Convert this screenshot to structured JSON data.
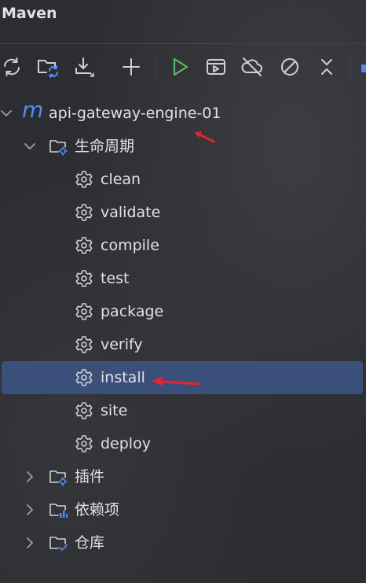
{
  "panel": {
    "title": "Maven"
  },
  "toolbar": {
    "buttons": [
      {
        "icon": "reload-icon"
      },
      {
        "icon": "generate-sources-icon"
      },
      {
        "icon": "download-icon"
      },
      {
        "icon": "add-icon"
      },
      {
        "icon": "run-icon"
      },
      {
        "icon": "execute-goal-icon"
      },
      {
        "icon": "offline-icon"
      },
      {
        "icon": "skip-tests-icon"
      },
      {
        "icon": "collapse-all-icon"
      }
    ]
  },
  "tree": {
    "project": {
      "label": "api-gateway-engine-01",
      "logo": "m"
    },
    "lifecycle": {
      "label": "生命周期",
      "goals": [
        {
          "label": "clean"
        },
        {
          "label": "validate"
        },
        {
          "label": "compile"
        },
        {
          "label": "test"
        },
        {
          "label": "package"
        },
        {
          "label": "verify"
        },
        {
          "label": "install",
          "selected": true
        },
        {
          "label": "site"
        },
        {
          "label": "deploy"
        }
      ]
    },
    "plugins": {
      "label": "插件"
    },
    "dependencies": {
      "label": "依赖项"
    },
    "repositories": {
      "label": "仓库"
    }
  },
  "colors": {
    "background": "#2b2d30",
    "selection": "#3a4f7a",
    "maven_blue": "#548af7",
    "run_green": "#5fb865",
    "annotation_red": "#e5252a"
  }
}
